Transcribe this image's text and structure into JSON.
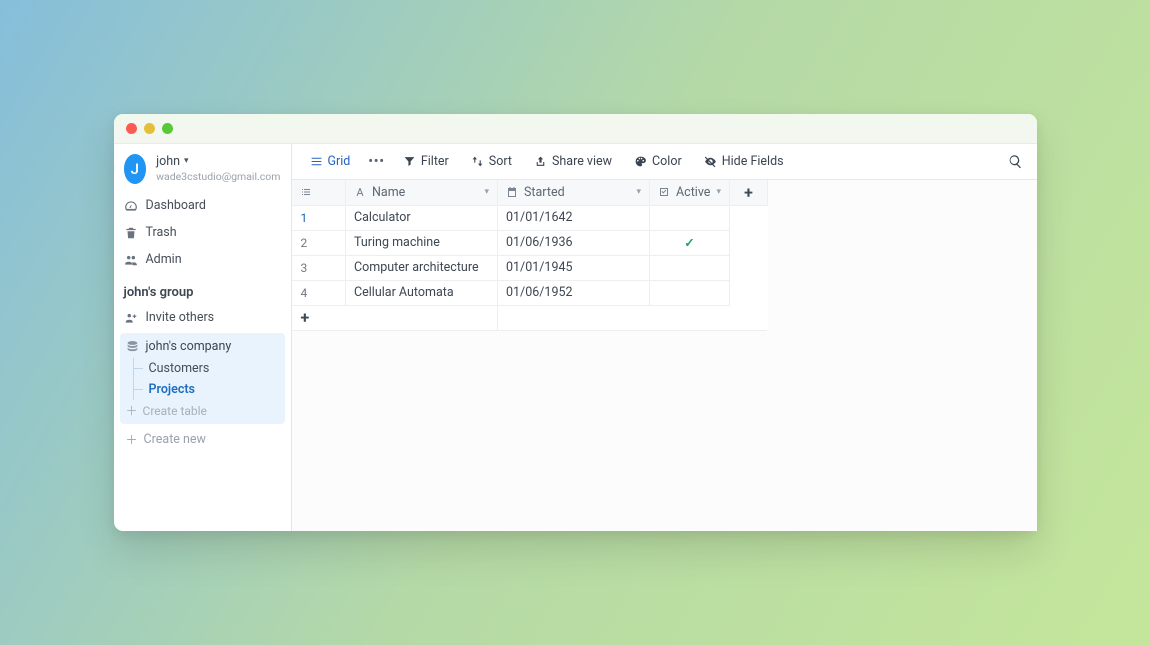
{
  "user": {
    "initial": "J",
    "name": "john",
    "email": "wade3cstudio@gmail.com"
  },
  "sidebar": {
    "nav": {
      "dashboard": "Dashboard",
      "trash": "Trash",
      "admin": "Admin"
    },
    "group_title": "john's group",
    "invite_others": "Invite others",
    "database_name": "john's company",
    "tables": [
      {
        "label": "Customers",
        "active": false
      },
      {
        "label": "Projects",
        "active": true
      }
    ],
    "create_table": "Create table",
    "create_new": "Create new"
  },
  "toolbar": {
    "view": "Grid",
    "filter": "Filter",
    "sort": "Sort",
    "share": "Share view",
    "color": "Color",
    "hide_fields": "Hide Fields"
  },
  "columns": {
    "name": {
      "label": "Name",
      "type": "text"
    },
    "started": {
      "label": "Started",
      "type": "date"
    },
    "active": {
      "label": "Active",
      "type": "bool"
    }
  },
  "rows": [
    {
      "n": "1",
      "name": "Calculator",
      "started": "01/01/1642",
      "active": false
    },
    {
      "n": "2",
      "name": "Turing machine",
      "started": "01/06/1936",
      "active": true
    },
    {
      "n": "3",
      "name": "Computer architecture",
      "started": "01/01/1945",
      "active": false
    },
    {
      "n": "4",
      "name": "Cellular Automata",
      "started": "01/06/1952",
      "active": false
    }
  ]
}
